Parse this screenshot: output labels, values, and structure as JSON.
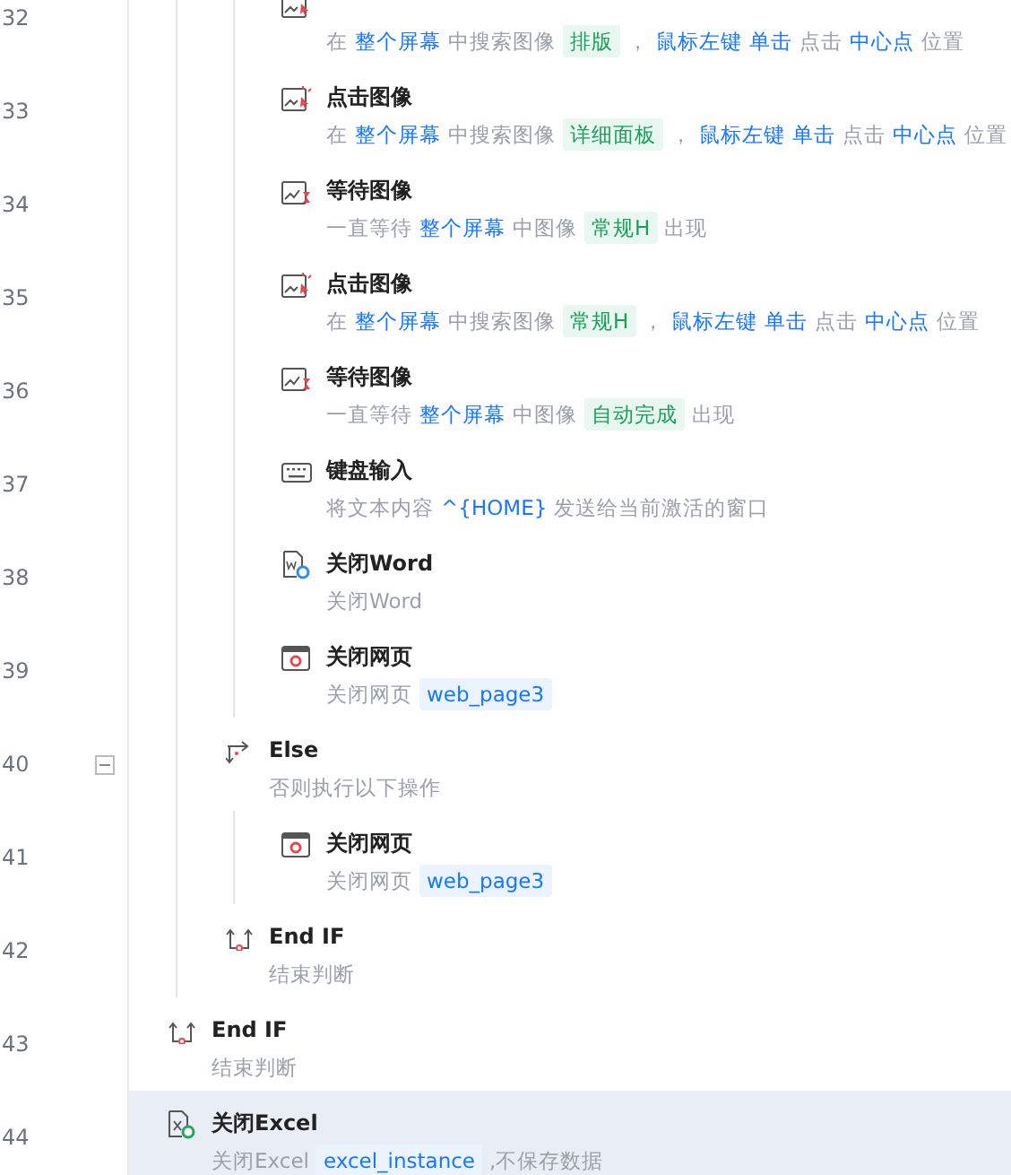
{
  "steps": [
    {
      "kind": "group",
      "children": [
        {
          "kind": "group",
          "children": [
            {
              "line": "32",
              "kind": "click_image",
              "desc": [
                {
                  "kind": "text",
                  "text": "在"
                },
                {
                  "kind": "var",
                  "text": "整个屏幕"
                },
                {
                  "kind": "text",
                  "text": "中搜索图像"
                },
                {
                  "kind": "image",
                  "text": "排版"
                },
                {
                  "kind": "text",
                  "text": "，"
                },
                {
                  "kind": "var",
                  "text": "鼠标左键"
                },
                {
                  "kind": "var",
                  "text": "单击"
                },
                {
                  "kind": "text",
                  "text": "点击"
                },
                {
                  "kind": "var",
                  "text": "中心点"
                },
                {
                  "kind": "text",
                  "text": "位置"
                }
              ]
            },
            {
              "line": "33",
              "kind": "click_image",
              "title": "点击图像",
              "desc": [
                {
                  "kind": "text",
                  "text": "在"
                },
                {
                  "kind": "var",
                  "text": "整个屏幕"
                },
                {
                  "kind": "text",
                  "text": "中搜索图像"
                },
                {
                  "kind": "image",
                  "text": "详细面板"
                },
                {
                  "kind": "text",
                  "text": "，"
                },
                {
                  "kind": "var",
                  "text": "鼠标左键"
                },
                {
                  "kind": "var",
                  "text": "单击"
                },
                {
                  "kind": "text",
                  "text": "点击"
                },
                {
                  "kind": "var",
                  "text": "中心点"
                },
                {
                  "kind": "text",
                  "text": "位置"
                }
              ]
            },
            {
              "line": "34",
              "kind": "wait_image",
              "title": "等待图像",
              "desc": [
                {
                  "kind": "text",
                  "text": "一直等待"
                },
                {
                  "kind": "var",
                  "text": "整个屏幕"
                },
                {
                  "kind": "text",
                  "text": "中图像"
                },
                {
                  "kind": "image",
                  "text": "常规H"
                },
                {
                  "kind": "text",
                  "text": "出现"
                }
              ]
            },
            {
              "line": "35",
              "kind": "click_image",
              "title": "点击图像",
              "desc": [
                {
                  "kind": "text",
                  "text": "在"
                },
                {
                  "kind": "var",
                  "text": "整个屏幕"
                },
                {
                  "kind": "text",
                  "text": "中搜索图像"
                },
                {
                  "kind": "image",
                  "text": "常规H"
                },
                {
                  "kind": "text",
                  "text": "，"
                },
                {
                  "kind": "var",
                  "text": "鼠标左键"
                },
                {
                  "kind": "var",
                  "text": "单击"
                },
                {
                  "kind": "text",
                  "text": "点击"
                },
                {
                  "kind": "var",
                  "text": "中心点"
                },
                {
                  "kind": "text",
                  "text": "位置"
                }
              ]
            },
            {
              "line": "36",
              "kind": "wait_image",
              "title": "等待图像",
              "desc": [
                {
                  "kind": "text",
                  "text": "一直等待"
                },
                {
                  "kind": "var",
                  "text": "整个屏幕"
                },
                {
                  "kind": "text",
                  "text": "中图像"
                },
                {
                  "kind": "image",
                  "text": "自动完成"
                },
                {
                  "kind": "text",
                  "text": "出现"
                }
              ]
            },
            {
              "line": "37",
              "kind": "keyboard",
              "title": "键盘输入",
              "desc": [
                {
                  "kind": "text",
                  "text": "将文本内容"
                },
                {
                  "kind": "var",
                  "text": "^{HOME}"
                },
                {
                  "kind": "text",
                  "text": "发送给当前激活的窗口"
                }
              ]
            },
            {
              "line": "38",
              "kind": "close_word",
              "title": "关闭Word",
              "desc": [
                {
                  "kind": "text",
                  "text": "关闭Word"
                }
              ]
            },
            {
              "line": "39",
              "kind": "close_webpage",
              "title": "关闭网页",
              "desc": [
                {
                  "kind": "text",
                  "text": "关闭网页"
                },
                {
                  "kind": "value",
                  "text": "web_page3"
                }
              ]
            }
          ]
        },
        {
          "line": "40",
          "kind": "else",
          "title": "Else",
          "expanded": true,
          "desc": [
            {
              "kind": "text",
              "text": "否则执行以下操作"
            }
          ],
          "children": [
            {
              "line": "41",
              "kind": "close_webpage",
              "title": "关闭网页",
              "desc": [
                {
                  "kind": "text",
                  "text": "关闭网页"
                },
                {
                  "kind": "value",
                  "text": "web_page3"
                }
              ]
            }
          ]
        },
        {
          "line": "42",
          "kind": "end_if",
          "title": "End IF",
          "desc": [
            {
              "kind": "text",
              "text": "结束判断"
            }
          ]
        }
      ]
    },
    {
      "line": "43",
      "kind": "end_if",
      "title": "End IF",
      "desc": [
        {
          "kind": "text",
          "text": "结束判断"
        }
      ]
    },
    {
      "line": "44",
      "kind": "close_excel",
      "title": "关闭Excel",
      "selected": true,
      "desc": [
        {
          "kind": "text",
          "text": "关闭Excel"
        },
        {
          "kind": "value",
          "text": "excel_instance"
        },
        {
          "kind": "text",
          "text": ",不保存数据"
        }
      ]
    }
  ]
}
